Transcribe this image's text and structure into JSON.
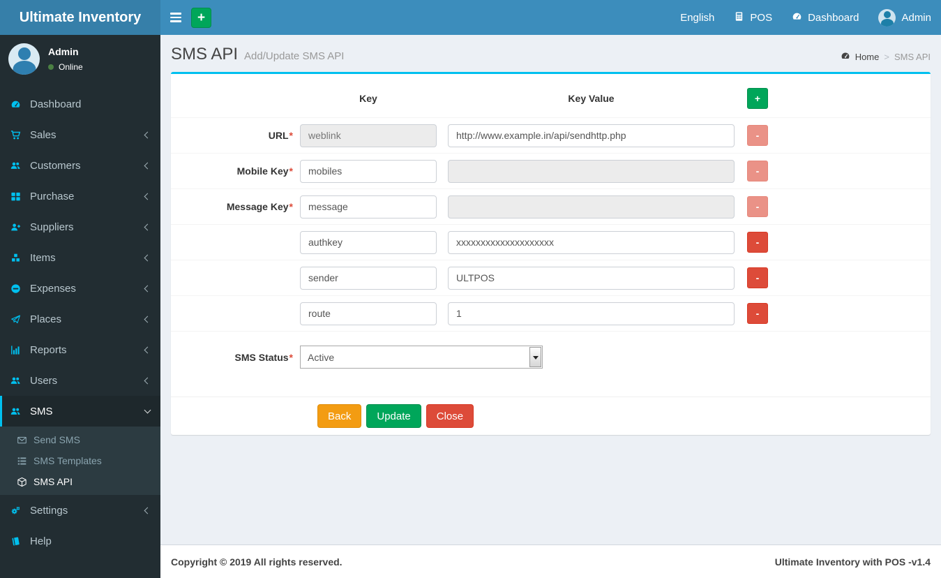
{
  "navbar": {
    "brand": "Ultimate Inventory",
    "quick_add_label": "+",
    "language": "English",
    "pos_label": "POS",
    "dashboard_label": "Dashboard",
    "user_label": "Admin"
  },
  "sidebar": {
    "user": {
      "name": "Admin",
      "status": "Online"
    },
    "items": [
      {
        "label": "Dashboard",
        "icon": "gauge-icon"
      },
      {
        "label": "Sales",
        "icon": "cart-icon"
      },
      {
        "label": "Customers",
        "icon": "users-icon"
      },
      {
        "label": "Purchase",
        "icon": "grid-icon"
      },
      {
        "label": "Suppliers",
        "icon": "user-plus-icon"
      },
      {
        "label": "Items",
        "icon": "cubes-icon"
      },
      {
        "label": "Expenses",
        "icon": "minus-circle-icon"
      },
      {
        "label": "Places",
        "icon": "paper-plane-icon"
      },
      {
        "label": "Reports",
        "icon": "bar-chart-icon"
      },
      {
        "label": "Users",
        "icon": "users-icon"
      },
      {
        "label": "SMS",
        "icon": "users-icon",
        "active": true,
        "expanded": true,
        "children": [
          {
            "label": "Send SMS",
            "icon": "envelope-icon"
          },
          {
            "label": "SMS Templates",
            "icon": "list-icon"
          },
          {
            "label": "SMS API",
            "icon": "cube-icon",
            "active": true
          }
        ]
      },
      {
        "label": "Settings",
        "icon": "gears-icon"
      },
      {
        "label": "Help",
        "icon": "book-icon"
      }
    ]
  },
  "page": {
    "title": "SMS API",
    "subtitle": "Add/Update SMS API",
    "breadcrumb": {
      "home": "Home",
      "separator": ">",
      "current": "SMS API"
    }
  },
  "form": {
    "header": {
      "key": "Key",
      "key_value": "Key Value",
      "add_label": "+"
    },
    "rows": [
      {
        "label": "URL",
        "required": "*",
        "key": "weblink",
        "value": "http://www.example.in/api/sendhttp.php",
        "key_disabled": true,
        "value_disabled": false,
        "remove_label": "-",
        "remove_enabled": false
      },
      {
        "label": "Mobile Key",
        "required": "*",
        "key": "mobiles",
        "value": "",
        "key_disabled": false,
        "value_disabled": true,
        "remove_label": "-",
        "remove_enabled": false
      },
      {
        "label": "Message Key",
        "required": "*",
        "key": "message",
        "value": "",
        "key_disabled": false,
        "value_disabled": true,
        "remove_label": "-",
        "remove_enabled": false
      },
      {
        "label": "",
        "required": "",
        "key": "authkey",
        "value": "xxxxxxxxxxxxxxxxxxxx",
        "key_disabled": false,
        "value_disabled": false,
        "remove_label": "-",
        "remove_enabled": true
      },
      {
        "label": "",
        "required": "",
        "key": "sender",
        "value": "ULTPOS",
        "key_disabled": false,
        "value_disabled": false,
        "remove_label": "-",
        "remove_enabled": true
      },
      {
        "label": "",
        "required": "",
        "key": "route",
        "value": "1",
        "key_disabled": false,
        "value_disabled": false,
        "remove_label": "-",
        "remove_enabled": true
      }
    ],
    "sms_status": {
      "label": "SMS Status",
      "required": "*",
      "selected": "Active"
    },
    "buttons": {
      "back": "Back",
      "update": "Update",
      "close": "Close"
    }
  },
  "footer": {
    "left": "Copyright © 2019 All rights reserved.",
    "right": "Ultimate Inventory with POS -v1.4"
  },
  "colors": {
    "navbar_blue": "#3c8dbc",
    "logo_blue": "#367fa9",
    "sidebar_dark": "#222d32",
    "accent_cyan": "#00c0ef",
    "green": "#00a65a",
    "orange": "#f39c12",
    "red": "#dd4b39",
    "content_bg": "#ecf0f5",
    "online_dot": "#4b8043"
  }
}
